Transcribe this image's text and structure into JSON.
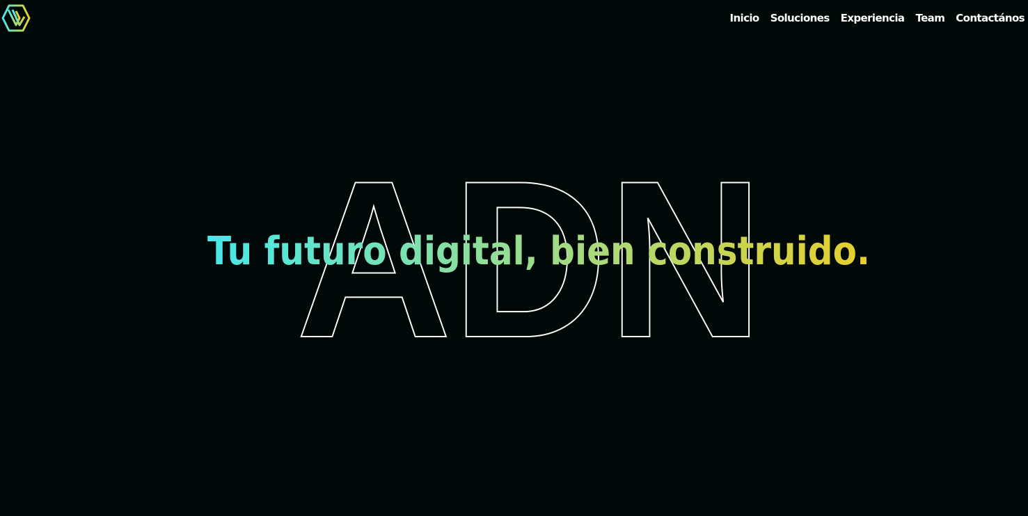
{
  "brand": {
    "logo_icon": "adn-hexagon-logo-icon",
    "gradient_start": "#46e8ea",
    "gradient_end": "#e8cf2a"
  },
  "nav": {
    "items": [
      {
        "label": "Inicio"
      },
      {
        "label": "Soluciones"
      },
      {
        "label": "Experiencia"
      },
      {
        "label": "Team"
      },
      {
        "label": "Contactános"
      }
    ]
  },
  "hero": {
    "background_word": "ADN",
    "outline_color": "#ffffff",
    "tagline": "Tu futuro digital, bien construido."
  },
  "colors": {
    "background": "#010808",
    "text": "#ffffff"
  }
}
